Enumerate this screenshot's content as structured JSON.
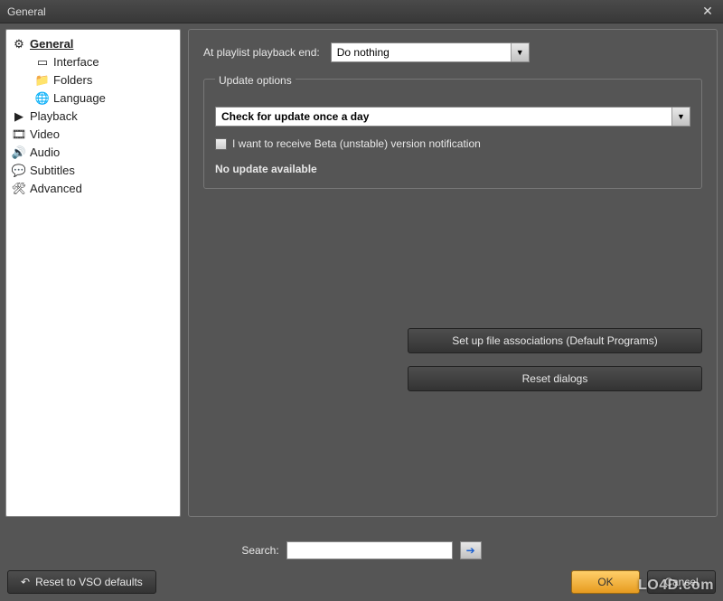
{
  "titlebar": {
    "title": "General",
    "close_glyph": "✕"
  },
  "sidebar": {
    "items": [
      {
        "label": "General",
        "selected": true,
        "icon": "gear-icon",
        "glyph": "⚙"
      },
      {
        "label": "Interface",
        "child": true,
        "icon": "window-icon",
        "glyph": "▭"
      },
      {
        "label": "Folders",
        "child": true,
        "icon": "folder-icon",
        "glyph": "📁"
      },
      {
        "label": "Language",
        "child": true,
        "icon": "globe-icon",
        "glyph": "🌐"
      },
      {
        "label": "Playback",
        "icon": "play-icon",
        "glyph": "▶"
      },
      {
        "label": "Video",
        "icon": "film-icon",
        "glyph": "🎞"
      },
      {
        "label": "Audio",
        "icon": "speaker-icon",
        "glyph": "🔊"
      },
      {
        "label": "Subtitles",
        "icon": "caption-icon",
        "glyph": "💬"
      },
      {
        "label": "Advanced",
        "icon": "tools-icon",
        "glyph": "🛠"
      }
    ]
  },
  "main": {
    "playlist_end_label": "At playlist playback end:",
    "playlist_end_value": "Do nothing",
    "update_legend": "Update options",
    "update_combo": "Check for update once a day",
    "beta_label": "I want to receive Beta (unstable) version notification",
    "no_update": "No update available",
    "file_assoc_btn": "Set up file associations (Default Programs)",
    "reset_dialogs_btn": "Reset dialogs"
  },
  "search": {
    "label": "Search:",
    "value": "",
    "go_glyph": "➔"
  },
  "footer": {
    "reset_glyph": "↶",
    "reset_label": "Reset to VSO defaults",
    "ok_label": "OK",
    "cancel_label": "Cancel"
  },
  "watermark": "LO4D.com"
}
